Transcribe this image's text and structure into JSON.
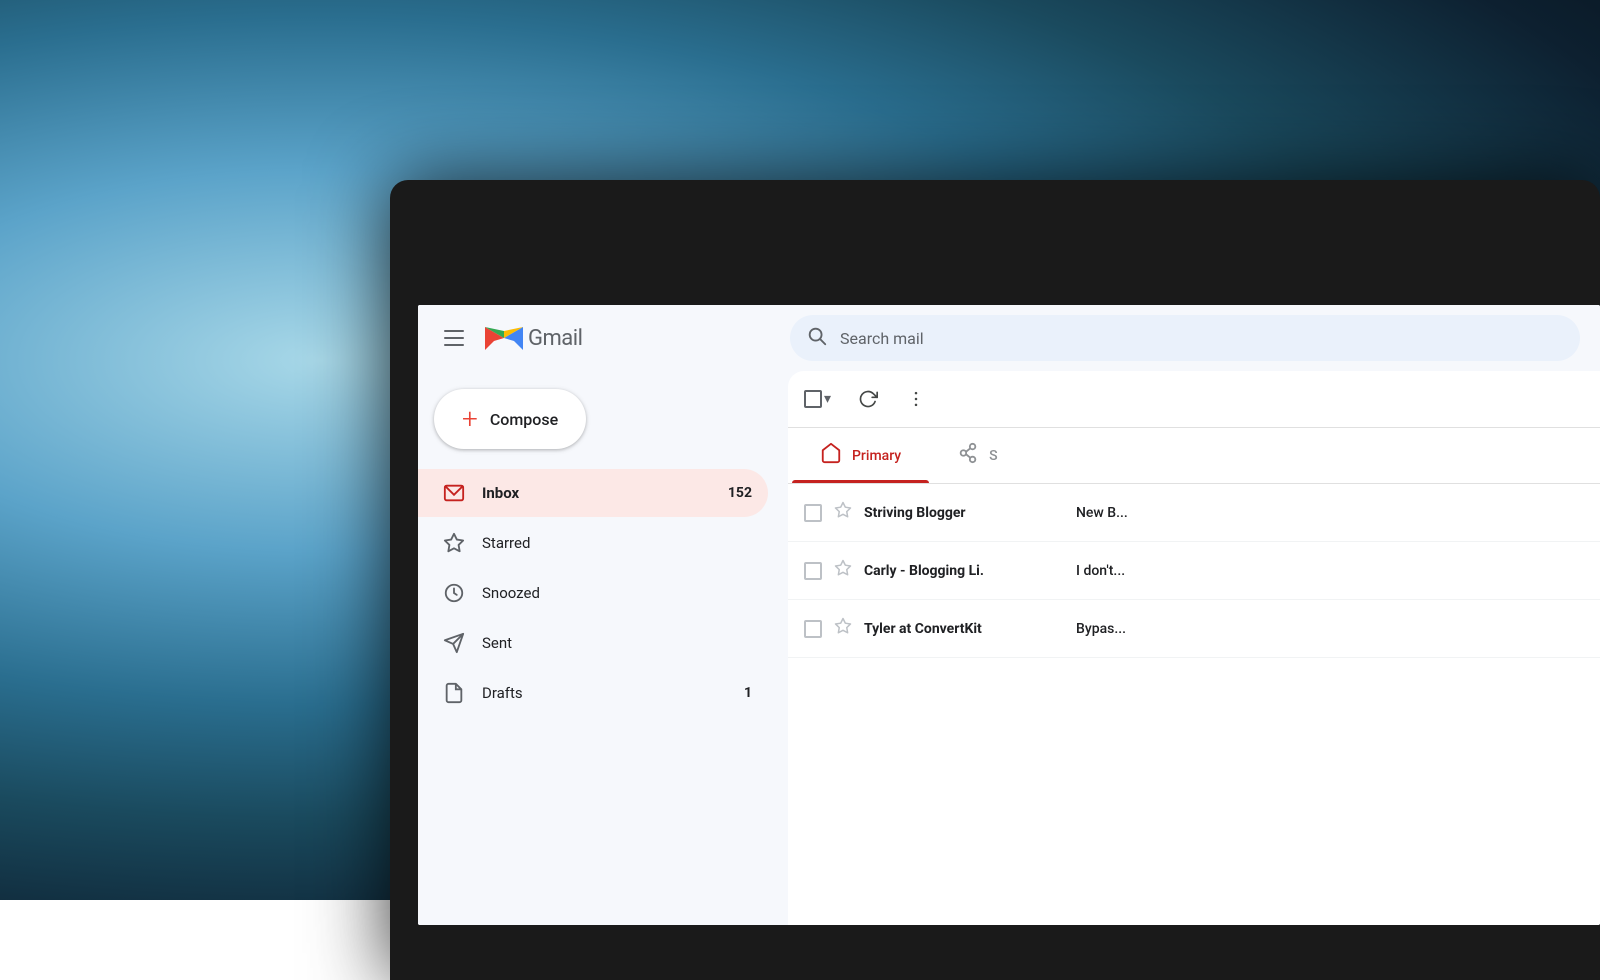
{
  "background": {
    "description": "blurred teal ocean/cloud background"
  },
  "header": {
    "menu_label": "Main menu",
    "logo_text": "Gmail",
    "search_placeholder": "Search mail"
  },
  "compose": {
    "label": "Compose",
    "plus_icon": "+"
  },
  "sidebar": {
    "items": [
      {
        "id": "inbox",
        "label": "Inbox",
        "badge": "152",
        "active": true
      },
      {
        "id": "starred",
        "label": "Starred",
        "badge": "",
        "active": false
      },
      {
        "id": "snoozed",
        "label": "Snoozed",
        "badge": "",
        "active": false
      },
      {
        "id": "sent",
        "label": "Sent",
        "badge": "",
        "active": false
      },
      {
        "id": "drafts",
        "label": "Drafts",
        "badge": "1",
        "active": false
      }
    ]
  },
  "toolbar": {
    "select_label": "Select",
    "refresh_label": "Refresh",
    "more_label": "More"
  },
  "tabs": [
    {
      "id": "primary",
      "label": "Primary",
      "active": true
    },
    {
      "id": "social",
      "label": "S...",
      "active": false
    }
  ],
  "emails": [
    {
      "sender": "Striving Blogger",
      "snippet": "New B..."
    },
    {
      "sender": "Carly - Blogging Li.",
      "snippet": "I don't..."
    },
    {
      "sender": "Tyler at ConvertKit",
      "snippet": "Bypas..."
    }
  ]
}
